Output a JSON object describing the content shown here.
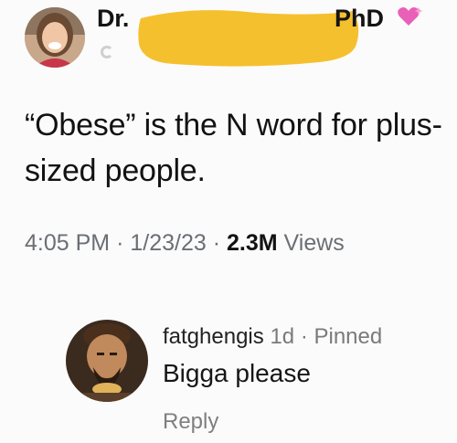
{
  "tweet": {
    "author_prefix": "Dr.",
    "author_suffix": "PhD",
    "emoji": "sparkling-heart",
    "text": "“Obese” is the N word for plus-sized people.",
    "time": "4:05 PM",
    "separator": "·",
    "date": "1/23/23",
    "views_count": "2.3M",
    "views_label": "Views"
  },
  "redaction_color": "#f5c02e",
  "comment": {
    "username": "fatghengis",
    "age": "1d",
    "separator": "·",
    "pinned_label": "Pinned",
    "text": "Bigga please",
    "reply_label": "Reply"
  }
}
